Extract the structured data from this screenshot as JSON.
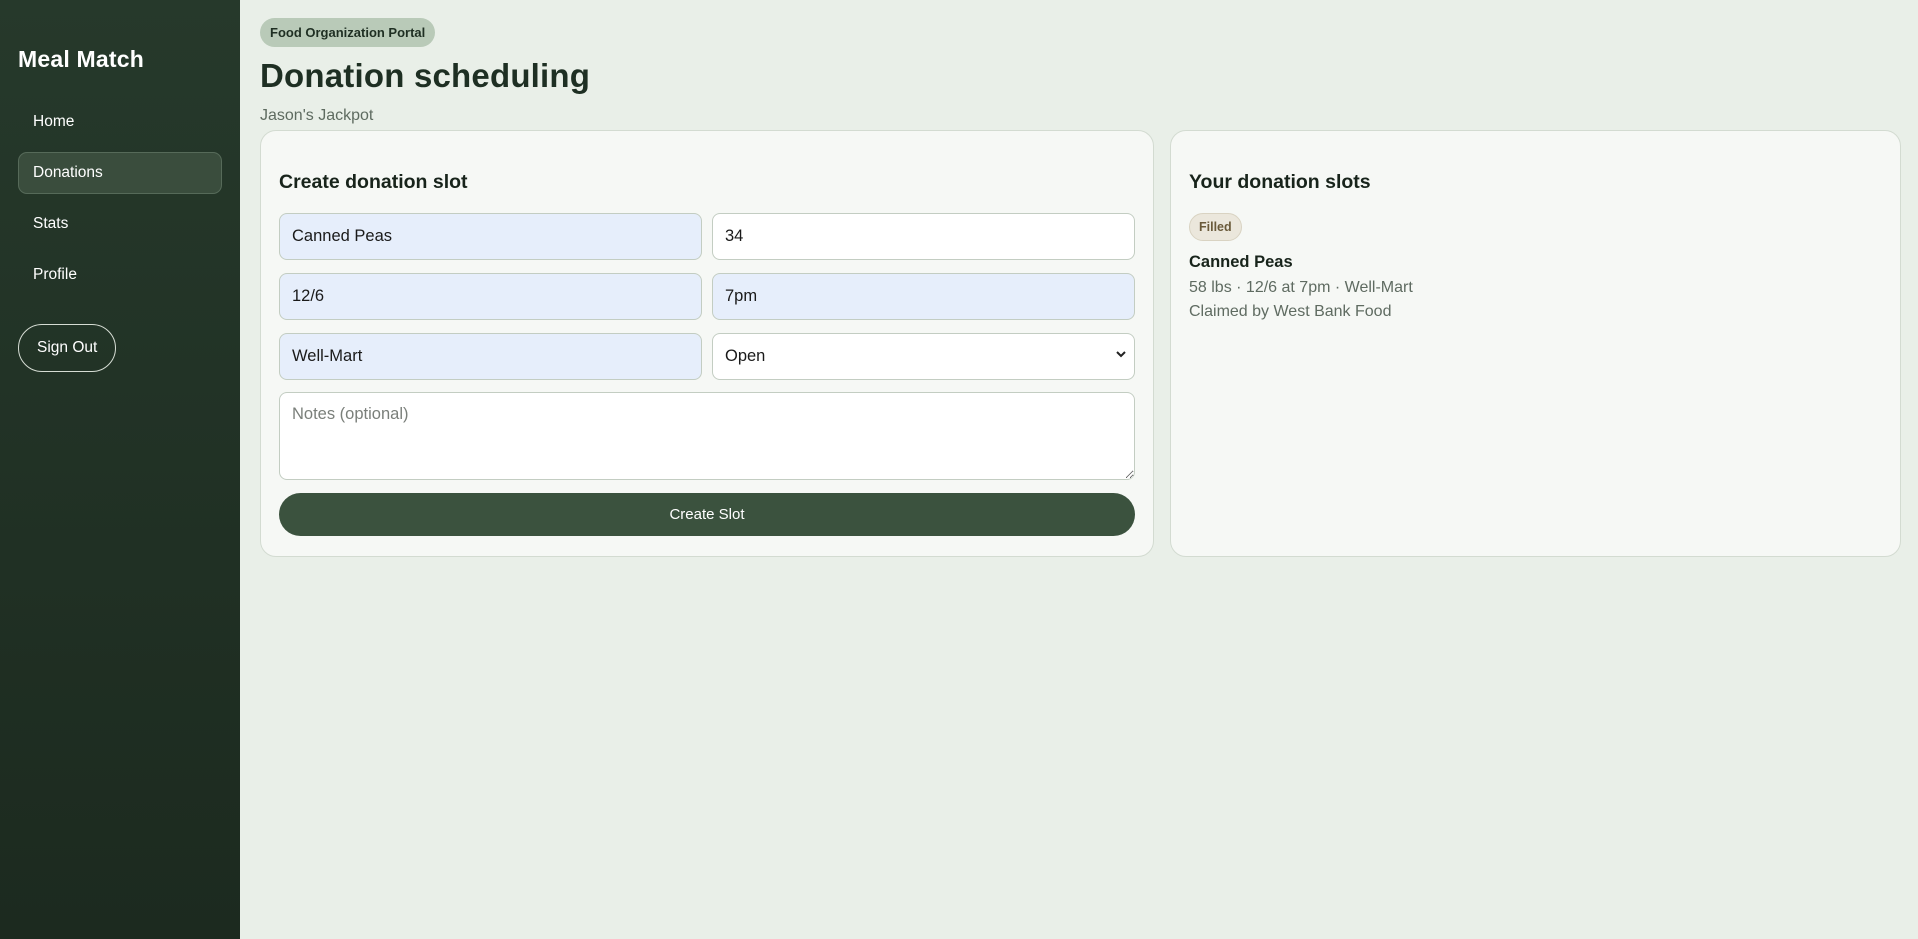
{
  "app": {
    "name": "Meal Match"
  },
  "sidebar": {
    "items": [
      {
        "label": "Home"
      },
      {
        "label": "Donations"
      },
      {
        "label": "Stats"
      },
      {
        "label": "Profile"
      }
    ],
    "active_index": 1,
    "signout_label": "Sign Out"
  },
  "header": {
    "badge": "Food Organization Portal",
    "title": "Donation scheduling",
    "subtitle": "Jason's Jackpot"
  },
  "form": {
    "title": "Create donation slot",
    "item_value": "Canned Peas",
    "quantity_value": "34",
    "date_value": "12/6",
    "time_value": "7pm",
    "location_value": "Well-Mart",
    "status_value": "Open",
    "notes_placeholder": "Notes (optional)",
    "submit_label": "Create Slot"
  },
  "slots": {
    "title": "Your donation slots",
    "items": [
      {
        "status": "Filled",
        "name": "Canned Peas",
        "details": "58 lbs · 12/6 at 7pm · Well-Mart",
        "claim": "Claimed by West Bank Food"
      }
    ]
  },
  "colors": {
    "sidebar_bg": "#26392b",
    "accent_button": "#3b523e",
    "filled_input_bg": "#e6eefb",
    "page_bg": "#e9efe8"
  }
}
